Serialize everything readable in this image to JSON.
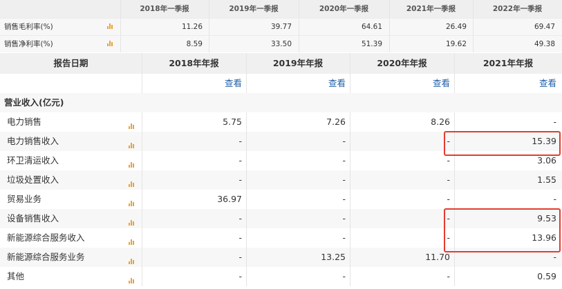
{
  "top_table": {
    "headers": [
      "2018年一季报",
      "2019年一季报",
      "2020年一季报",
      "2021年一季报",
      "2022年一季报"
    ],
    "rows": [
      {
        "label": "销售毛利率(%)",
        "chart_icon": "bar-chart-icon",
        "values": [
          "11.26",
          "39.77",
          "64.61",
          "26.49",
          "69.47"
        ]
      },
      {
        "label": "销售净利率(%)",
        "chart_icon": "bar-chart-icon",
        "values": [
          "8.59",
          "33.50",
          "51.39",
          "19.62",
          "49.38"
        ]
      }
    ]
  },
  "main_table": {
    "header_label": "报告日期",
    "headers": [
      "2018年年报",
      "2019年年报",
      "2020年年报",
      "2021年年报"
    ],
    "view_label": "查看",
    "section_label": "营业收入(亿元)",
    "rows": [
      {
        "label": "电力销售",
        "values": [
          "5.75",
          "7.26",
          "8.26",
          "-"
        ]
      },
      {
        "label": "电力销售收入",
        "values": [
          "-",
          "-",
          "-",
          "15.39"
        ]
      },
      {
        "label": "环卫清运收入",
        "values": [
          "-",
          "-",
          "-",
          "3.06"
        ]
      },
      {
        "label": "垃圾处置收入",
        "values": [
          "-",
          "-",
          "-",
          "1.55"
        ]
      },
      {
        "label": "贸易业务",
        "values": [
          "36.97",
          "-",
          "-",
          "-"
        ]
      },
      {
        "label": "设备销售收入",
        "values": [
          "-",
          "-",
          "-",
          "9.53"
        ]
      },
      {
        "label": "新能源综合服务收入",
        "values": [
          "-",
          "-",
          "-",
          "13.96"
        ]
      },
      {
        "label": "新能源综合服务业务",
        "values": [
          "-",
          "13.25",
          "11.70",
          "-"
        ]
      },
      {
        "label": "其他",
        "values": [
          "-",
          "-",
          "-",
          "0.59"
        ]
      }
    ]
  },
  "colors": {
    "highlight_border": "#e53a2e",
    "link": "#1f5fa8",
    "chart_icon": "#e8a23a"
  }
}
